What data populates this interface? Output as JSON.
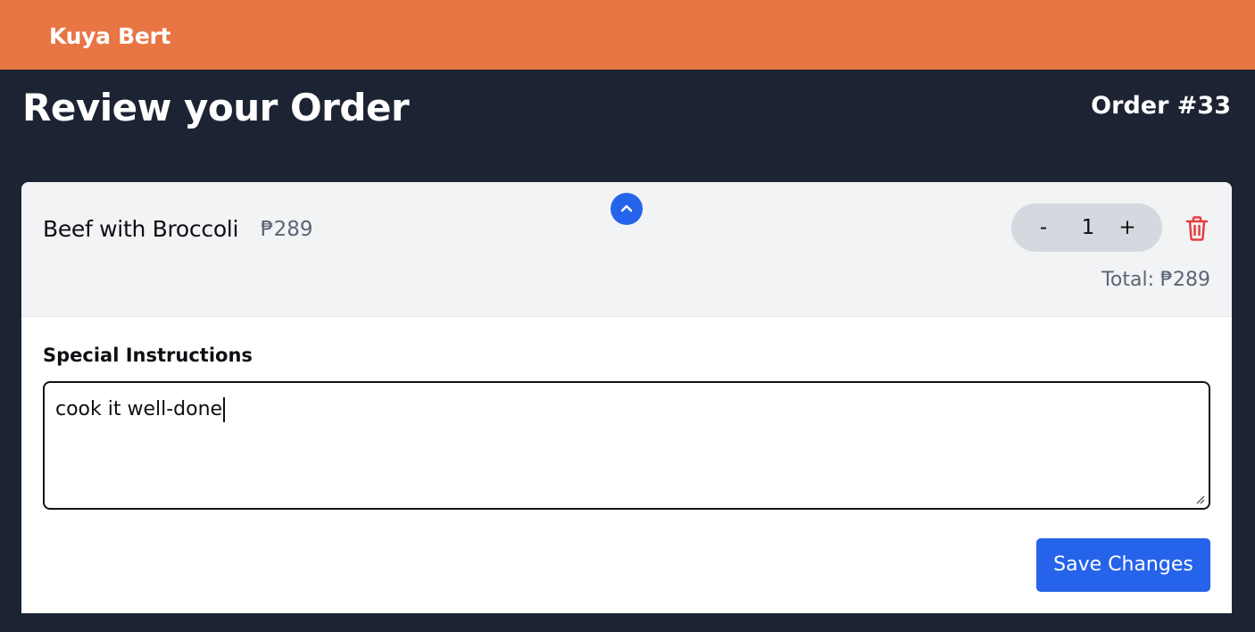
{
  "app": {
    "brand": "Kuya Bert"
  },
  "page": {
    "title": "Review your Order",
    "order_label": "Order #33"
  },
  "colors": {
    "header": "#e87544",
    "background": "#1c2434",
    "accent": "#2563eb",
    "danger": "#e53e3e"
  },
  "order_item": {
    "name": "Beef with Broccoli",
    "price": "₱289",
    "quantity": "1",
    "minus_label": "-",
    "plus_label": "+",
    "total_label": "Total: ₱289",
    "collapse_icon": "chevron-up-icon",
    "delete_icon": "trash-icon"
  },
  "instructions": {
    "label": "Special Instructions",
    "value": "cook it well-done"
  },
  "actions": {
    "save_label": "Save Changes"
  }
}
